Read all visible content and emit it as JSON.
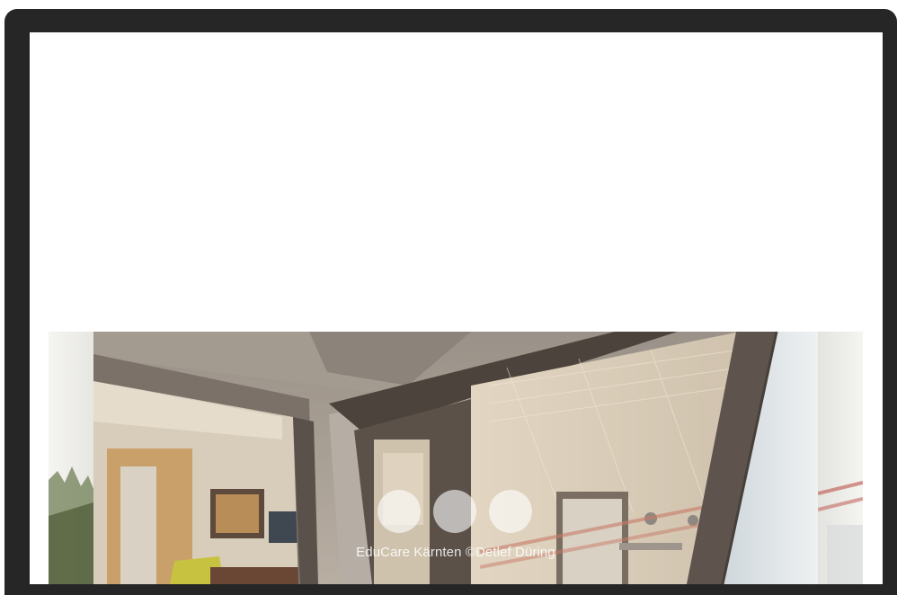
{
  "gallery": {
    "caption": "EduCare Kärnten ©Detlef Düring",
    "slide_count": 3,
    "photo_subject": "hotel-room-doorway"
  },
  "colors": {
    "frame": "#262626",
    "screen": "#ffffff",
    "dot": "#ffffff"
  }
}
